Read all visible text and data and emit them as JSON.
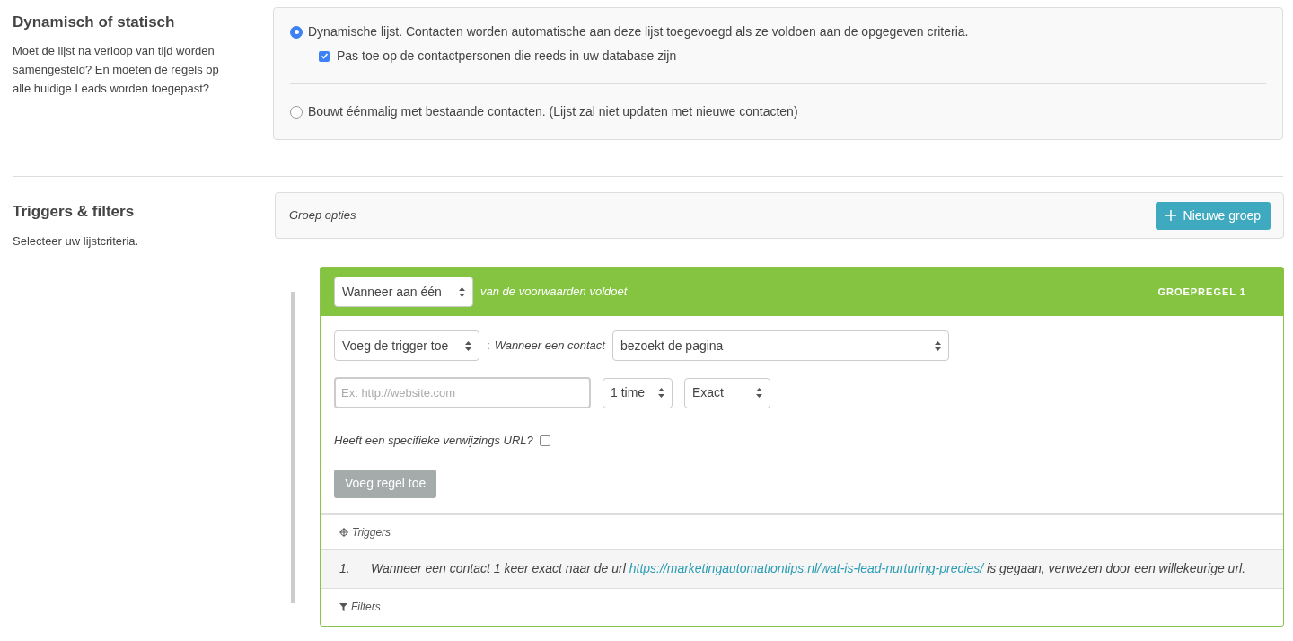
{
  "sections": [
    {
      "title": "Dynamisch of statisch",
      "description": "Moet de lijst na verloop van tijd worden samengesteld? En moeten de regels op alle huidige Leads worden toegepast?"
    },
    {
      "title": "Triggers & filters",
      "description": "Selecteer uw lijstcriteria."
    }
  ],
  "list_type": {
    "options": [
      {
        "label": "Dynamische lijst. Contacten worden automatische aan deze lijst toegevoegd als ze voldoen aan de opgegeven criteria.",
        "selected": true,
        "sub_option": {
          "label": "Pas toe op de contactpersonen die reeds in uw database zijn",
          "checked": true
        }
      },
      {
        "label": "Bouwt éénmalig met bestaande contacten. (Lijst zal niet updaten met nieuwe contacten)",
        "selected": false
      }
    ]
  },
  "group_options": {
    "label": "Groep opties",
    "button": "Nieuwe groep"
  },
  "group": {
    "match_select": "Wanneer aan één",
    "match_text": "van de voorwaarden voldoet",
    "title": "GROEPREGEL 1",
    "trigger_select": "Voeg de trigger toe",
    "separator": ":",
    "trigger_label": "Wanneer een contact",
    "action_select": "bezoekt de pagina",
    "url_field": {
      "placeholder": "Ex: http://website.com"
    },
    "times_select": "1 time",
    "match_mode_select": "Exact",
    "referrer": {
      "label": "Heeft een specifieke verwijzings URL?",
      "checked": false
    },
    "add_rule_button": "Voeg regel toe",
    "triggers_heading": "Triggers",
    "triggers": [
      {
        "number": "1.",
        "text_before": "Wanneer een contact 1 keer exact naar de url",
        "link": "https://marketingautomationtips.nl/wat-is-lead-nurturing-precies/",
        "text_after": "is gegaan, verwezen door een willekeurige url."
      }
    ],
    "filters_heading": "Filters"
  }
}
